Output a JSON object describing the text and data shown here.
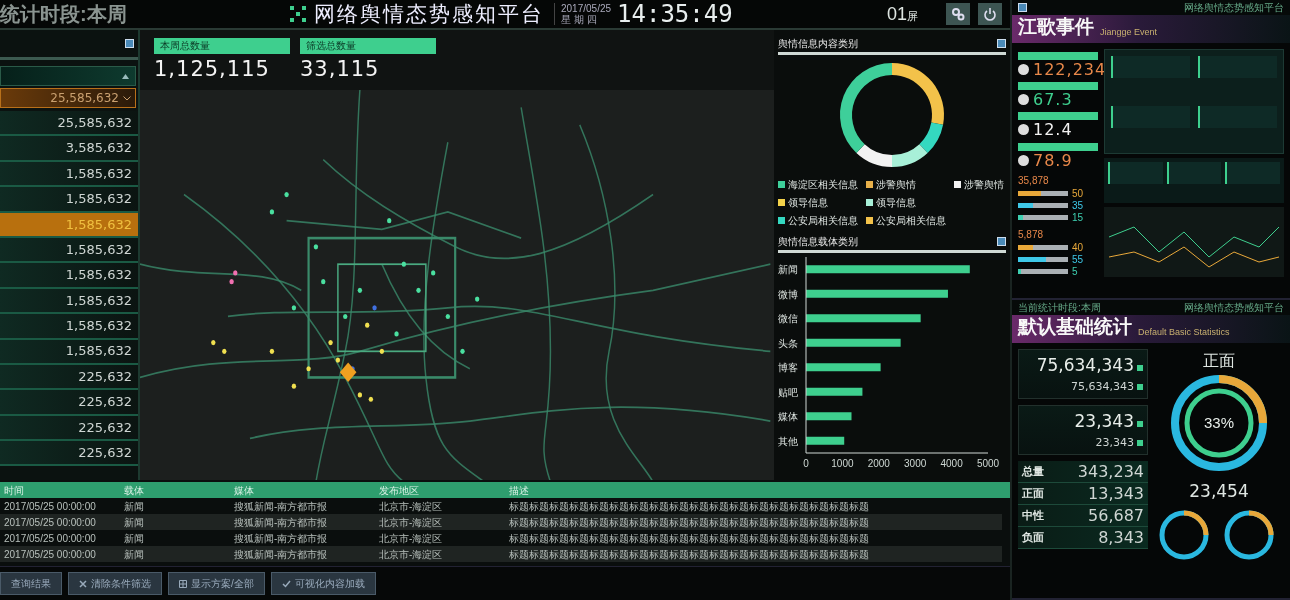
{
  "top_bar": {
    "period": "统计时段:本周",
    "title": "网络舆情态势感知平台",
    "date": "2017/05/25",
    "weekday": "星 期 四",
    "time": "14:35:49",
    "screen_no": "01",
    "screen_unit": "屏"
  },
  "left_list": {
    "filter_value": "25,585,632",
    "items": [
      {
        "value": "25,585,632",
        "selected": false
      },
      {
        "value": "3,585,632",
        "selected": false
      },
      {
        "value": "1,585,632",
        "selected": false
      },
      {
        "value": "1,585,632",
        "selected": false
      },
      {
        "value": "1,585,632",
        "selected": true
      },
      {
        "value": "1,585,632",
        "selected": false
      },
      {
        "value": "1,585,632",
        "selected": false
      },
      {
        "value": "1,585,632",
        "selected": false
      },
      {
        "value": "1,585,632",
        "selected": false
      },
      {
        "value": "1,585,632",
        "selected": false
      },
      {
        "value": "225,632",
        "selected": false
      },
      {
        "value": "225,632",
        "selected": false
      },
      {
        "value": "225,632",
        "selected": false
      },
      {
        "value": "225,632",
        "selected": false
      }
    ]
  },
  "stats": [
    {
      "label": "本周总数量",
      "value": "1,125,115"
    },
    {
      "label": "筛选总数量",
      "value": "33,115"
    }
  ],
  "content_panel": {
    "title": "舆情信息内容类别",
    "legend": [
      {
        "label": "海淀区相关信息",
        "color": "#3ecf9a"
      },
      {
        "label": "涉警舆情",
        "color": "#e8b04a"
      },
      {
        "label": "涉警舆情",
        "color": "#f2f2f2"
      },
      {
        "label": "领导信息",
        "color": "#f3d24a"
      },
      {
        "label": "领导信息",
        "color": "#a8f0d8"
      },
      {
        "label": "公安局相关信息",
        "color": "#34d8c0"
      },
      {
        "label": "公安局相关信息",
        "color": "#f3c24a"
      }
    ]
  },
  "carrier_panel": {
    "title": "舆情信息载体类别",
    "chart_data": {
      "type": "bar",
      "orientation": "horizontal",
      "categories": [
        "新闻",
        "微博",
        "微信",
        "头条",
        "博客",
        "贴吧",
        "媒体",
        "其他"
      ],
      "series": [
        {
          "color": "#3ecf8e",
          "values": [
            4500,
            3900,
            3150,
            2600,
            2050,
            1550,
            1250,
            1050
          ]
        }
      ],
      "xlim": [
        0,
        5000
      ],
      "xticks": [
        0,
        1000,
        2000,
        3000,
        4000,
        5000
      ]
    }
  },
  "table": {
    "columns": [
      "时间",
      "载体",
      "媒体",
      "发布地区",
      "描述"
    ],
    "rows": [
      [
        "2017/05/25 00:00:00",
        "新闻",
        "搜狐新闻-南方都市报",
        "北京市-海淀区",
        "标题标题标题标题标题标题标题标题标题标题标题标题标题标题标题标题标题标题"
      ],
      [
        "2017/05/25 00:00:00",
        "新闻",
        "搜狐新闻-南方都市报",
        "北京市-海淀区",
        "标题标题标题标题标题标题标题标题标题标题标题标题标题标题标题标题标题标题"
      ],
      [
        "2017/05/25 00:00:00",
        "新闻",
        "搜狐新闻-南方都市报",
        "北京市-海淀区",
        "标题标题标题标题标题标题标题标题标题标题标题标题标题标题标题标题标题标题"
      ],
      [
        "2017/05/25 00:00:00",
        "新闻",
        "搜狐新闻-南方都市报",
        "北京市-海淀区",
        "标题标题标题标题标题标题标题标题标题标题标题标题标题标题标题标题标题标题"
      ]
    ]
  },
  "buttons": [
    {
      "label": "查询结果",
      "kind": "plain"
    },
    {
      "label": "清除条件筛选",
      "kind": "clear"
    },
    {
      "label": "显示方案/全部",
      "kind": "grid"
    },
    {
      "label": "可视化内容加载",
      "kind": "check"
    }
  ],
  "event_screen": {
    "header": "网络舆情态势感知平台",
    "title": "江歌事件",
    "subtitle": "Jiangge Event",
    "metrics": [
      {
        "value": "122,234",
        "color": "#e8884a"
      },
      {
        "value": "67.3",
        "color": "#3ecf8e"
      },
      {
        "value": "12.4",
        "color": "#f2f2f2"
      },
      {
        "value": "78.9",
        "color": "#e8884a"
      }
    ],
    "groups": [
      {
        "total": "35,878",
        "bars": [
          {
            "level": 0.45,
            "reading": "50",
            "color": "#e8a83a"
          },
          {
            "level": 0.3,
            "reading": "35",
            "color": "#3ec8e8"
          },
          {
            "level": 0.1,
            "reading": "15",
            "color": "#3ecfb0"
          }
        ]
      },
      {
        "total": "5,878",
        "bars": [
          {
            "level": 0.3,
            "reading": "40",
            "color": "#e8a83a"
          },
          {
            "level": 0.55,
            "reading": "55",
            "color": "#3ec8e8"
          },
          {
            "level": 0.05,
            "reading": "5",
            "color": "#3ecfb0"
          }
        ]
      }
    ]
  },
  "stats_screen": {
    "period": "当前统计时段:本周",
    "header": "网络舆情态势感知平台",
    "title": "默认基础统计",
    "subtitle": "Default Basic Statistics",
    "cards": [
      {
        "value": "75,634,343",
        "sub": "75,634,343"
      },
      {
        "value": "23,343",
        "sub": "23,343"
      }
    ],
    "breakdown": [
      {
        "label": "总量",
        "value": "343,234"
      },
      {
        "label": "正面",
        "value": "13,343"
      },
      {
        "label": "中性",
        "value": "56,687"
      },
      {
        "label": "负面",
        "value": "8,343"
      }
    ],
    "ring": {
      "label": "正面",
      "percent": "33%",
      "total": "23,454"
    }
  }
}
